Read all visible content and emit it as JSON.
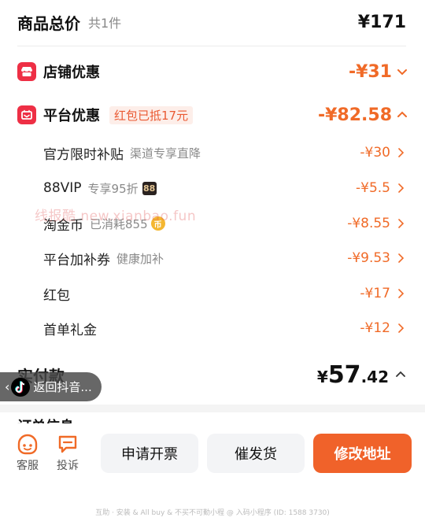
{
  "summary": {
    "title": "商品总价",
    "count": "共1件",
    "total": "¥171"
  },
  "groups": {
    "store": {
      "title": "店铺优惠",
      "amount": "-¥31",
      "icon": "store-icon"
    },
    "platform": {
      "title": "平台优惠",
      "tag": "红包已抵17元",
      "amount": "-¥82.58",
      "icon": "platform-icon"
    }
  },
  "items": [
    {
      "name": "官方限时补贴",
      "desc": "渠道专享直降",
      "amount": "-¥30"
    },
    {
      "name": "88VIP",
      "desc": "专享95折",
      "badge": "88",
      "amount": "-¥5.5"
    },
    {
      "name": "淘金币",
      "desc": "已消耗855",
      "badge": "币",
      "amount": "-¥8.55"
    },
    {
      "name": "平台加补券",
      "desc": "健康加补",
      "amount": "-¥9.53"
    },
    {
      "name": "红包",
      "desc": "",
      "amount": "-¥17"
    },
    {
      "name": "首单礼金",
      "desc": "",
      "amount": "-¥12"
    }
  ],
  "watermark": "线报酷 new.xianbao.fun",
  "payment": {
    "label": "实付款",
    "currency": "¥",
    "integer": "57",
    "decimal": ".42"
  },
  "back_pill": {
    "label": "返回抖音..."
  },
  "next_section": {
    "title": "订单信息"
  },
  "bottom_bar": {
    "service_label": "客服",
    "complaint_label": "投诉",
    "invoice_label": "申请开票",
    "urge_label": "催发货",
    "modify_address_label": "修改地址"
  },
  "footer": "互助 · 安装 & All buy & 不买不可勤小程 @ 入码小程序 (ID: 1588 3730)",
  "colors": {
    "accent": "#f06a27",
    "primary_button": "#f0622a",
    "badge_red": "#ee2f45"
  }
}
